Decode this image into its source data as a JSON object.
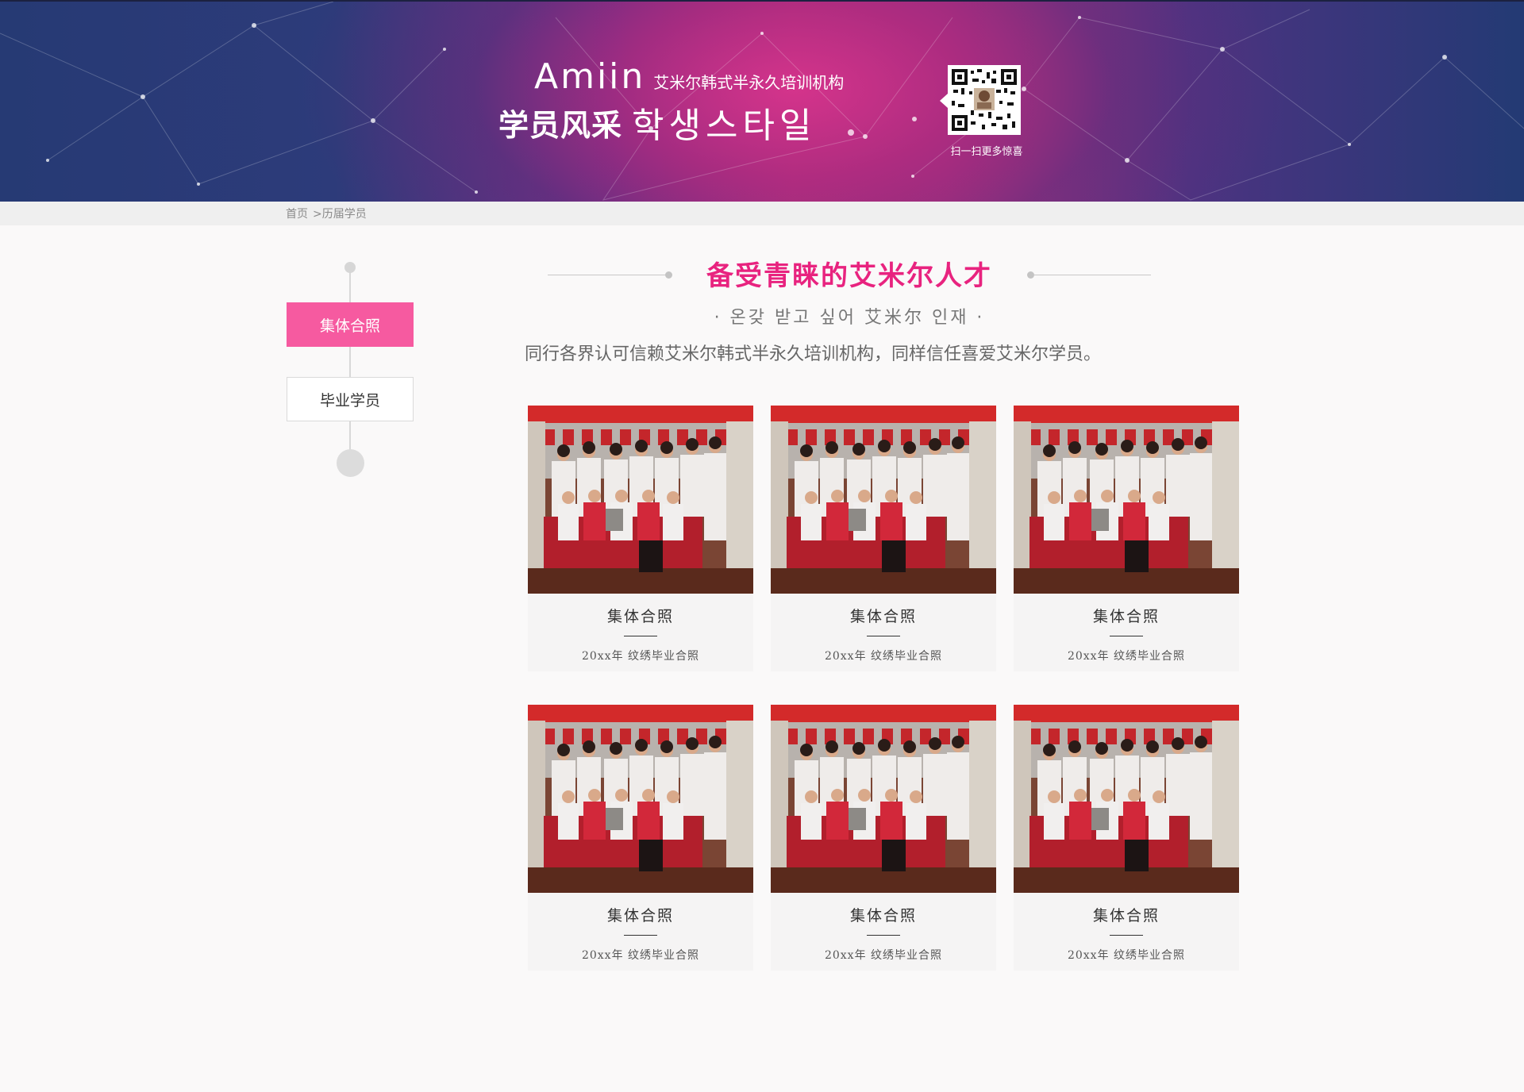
{
  "banner": {
    "brand_name": "Amiin",
    "brand_sub": "艾米尔韩式半永久培训机构",
    "title_cn": "学员风采",
    "title_kr": "학생스타일",
    "qr_caption": "扫一扫更多惊喜"
  },
  "breadcrumb": {
    "home": "首页",
    "current": ">历届学员"
  },
  "side_nav": {
    "items": [
      {
        "label": "集体合照",
        "active": true
      },
      {
        "label": "毕业学员",
        "active": false
      }
    ]
  },
  "section": {
    "heading": "备受青睐的艾米尔人才",
    "subheading_kr": "· 온갖 받고 싶어 艾米尔 인재 ·",
    "intro": "同行各界认可信赖艾米尔韩式半永久培训机构，同样信任喜爱艾米尔学员。"
  },
  "cards": [
    {
      "title": "集体合照",
      "desc": "20xx年 纹绣毕业合照"
    },
    {
      "title": "集体合照",
      "desc": "20xx年 纹绣毕业合照"
    },
    {
      "title": "集体合照",
      "desc": "20xx年 纹绣毕业合照"
    },
    {
      "title": "集体合照",
      "desc": "20xx年 纹绣毕业合照"
    },
    {
      "title": "集体合照",
      "desc": "20xx年 纹绣毕业合照"
    },
    {
      "title": "集体合照",
      "desc": "20xx年 纹绣毕业合照"
    }
  ],
  "colors": {
    "accent_pink": "#f65aa0",
    "heading_pink": "#e8237f",
    "banner_blue": "#263a74",
    "banner_magenta": "#b1307e"
  }
}
